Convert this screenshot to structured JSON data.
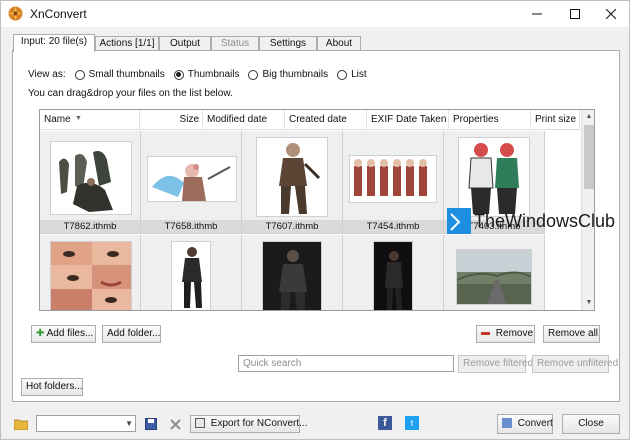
{
  "window": {
    "title": "XnConvert"
  },
  "tabs": [
    {
      "label": "Input: 20 file(s)",
      "active": true,
      "disabled": false
    },
    {
      "label": "Actions [1/1]",
      "active": false,
      "disabled": false
    },
    {
      "label": "Output",
      "active": false,
      "disabled": false
    },
    {
      "label": "Status",
      "active": false,
      "disabled": true
    },
    {
      "label": "Settings",
      "active": false,
      "disabled": false
    },
    {
      "label": "About",
      "active": false,
      "disabled": false
    }
  ],
  "view": {
    "label": "View as:",
    "options": [
      {
        "label": "Small thumbnails",
        "selected": false
      },
      {
        "label": "Thumbnails",
        "selected": true
      },
      {
        "label": "Big thumbnails",
        "selected": false
      },
      {
        "label": "List",
        "selected": false
      }
    ],
    "hint": "You can drag&drop your files on the list below."
  },
  "columns": [
    "Name",
    "Size",
    "Modified date",
    "Created date",
    "EXIF Date Taken",
    "Properties",
    "Print size"
  ],
  "files": [
    {
      "name": "T7862.ithmb"
    },
    {
      "name": "T7658.ithmb"
    },
    {
      "name": "T7607.ithmb"
    },
    {
      "name": "T7454.ithmb"
    },
    {
      "name": "T7403.ithmb"
    },
    {
      "name": ""
    },
    {
      "name": ""
    },
    {
      "name": ""
    },
    {
      "name": ""
    },
    {
      "name": ""
    }
  ],
  "buttons": {
    "add_files": "Add files...",
    "add_folder": "Add folder...",
    "remove": "Remove",
    "remove_all": "Remove all",
    "remove_filtered": "Remove filtered",
    "remove_unfiltered": "Remove unfiltered",
    "hot_folders": "Hot folders...",
    "export_nconvert": "Export for NConvert...",
    "convert": "Convert",
    "close": "Close"
  },
  "search": {
    "placeholder": "Quick search"
  },
  "watermark": "TheWindowsClub",
  "colors": {
    "accent_green": "#2e9e2e",
    "remove_red": "#c0392b",
    "facebook": "#3b5998",
    "twitter": "#1da1f2",
    "watermark_blue": "#1e8ee0"
  }
}
